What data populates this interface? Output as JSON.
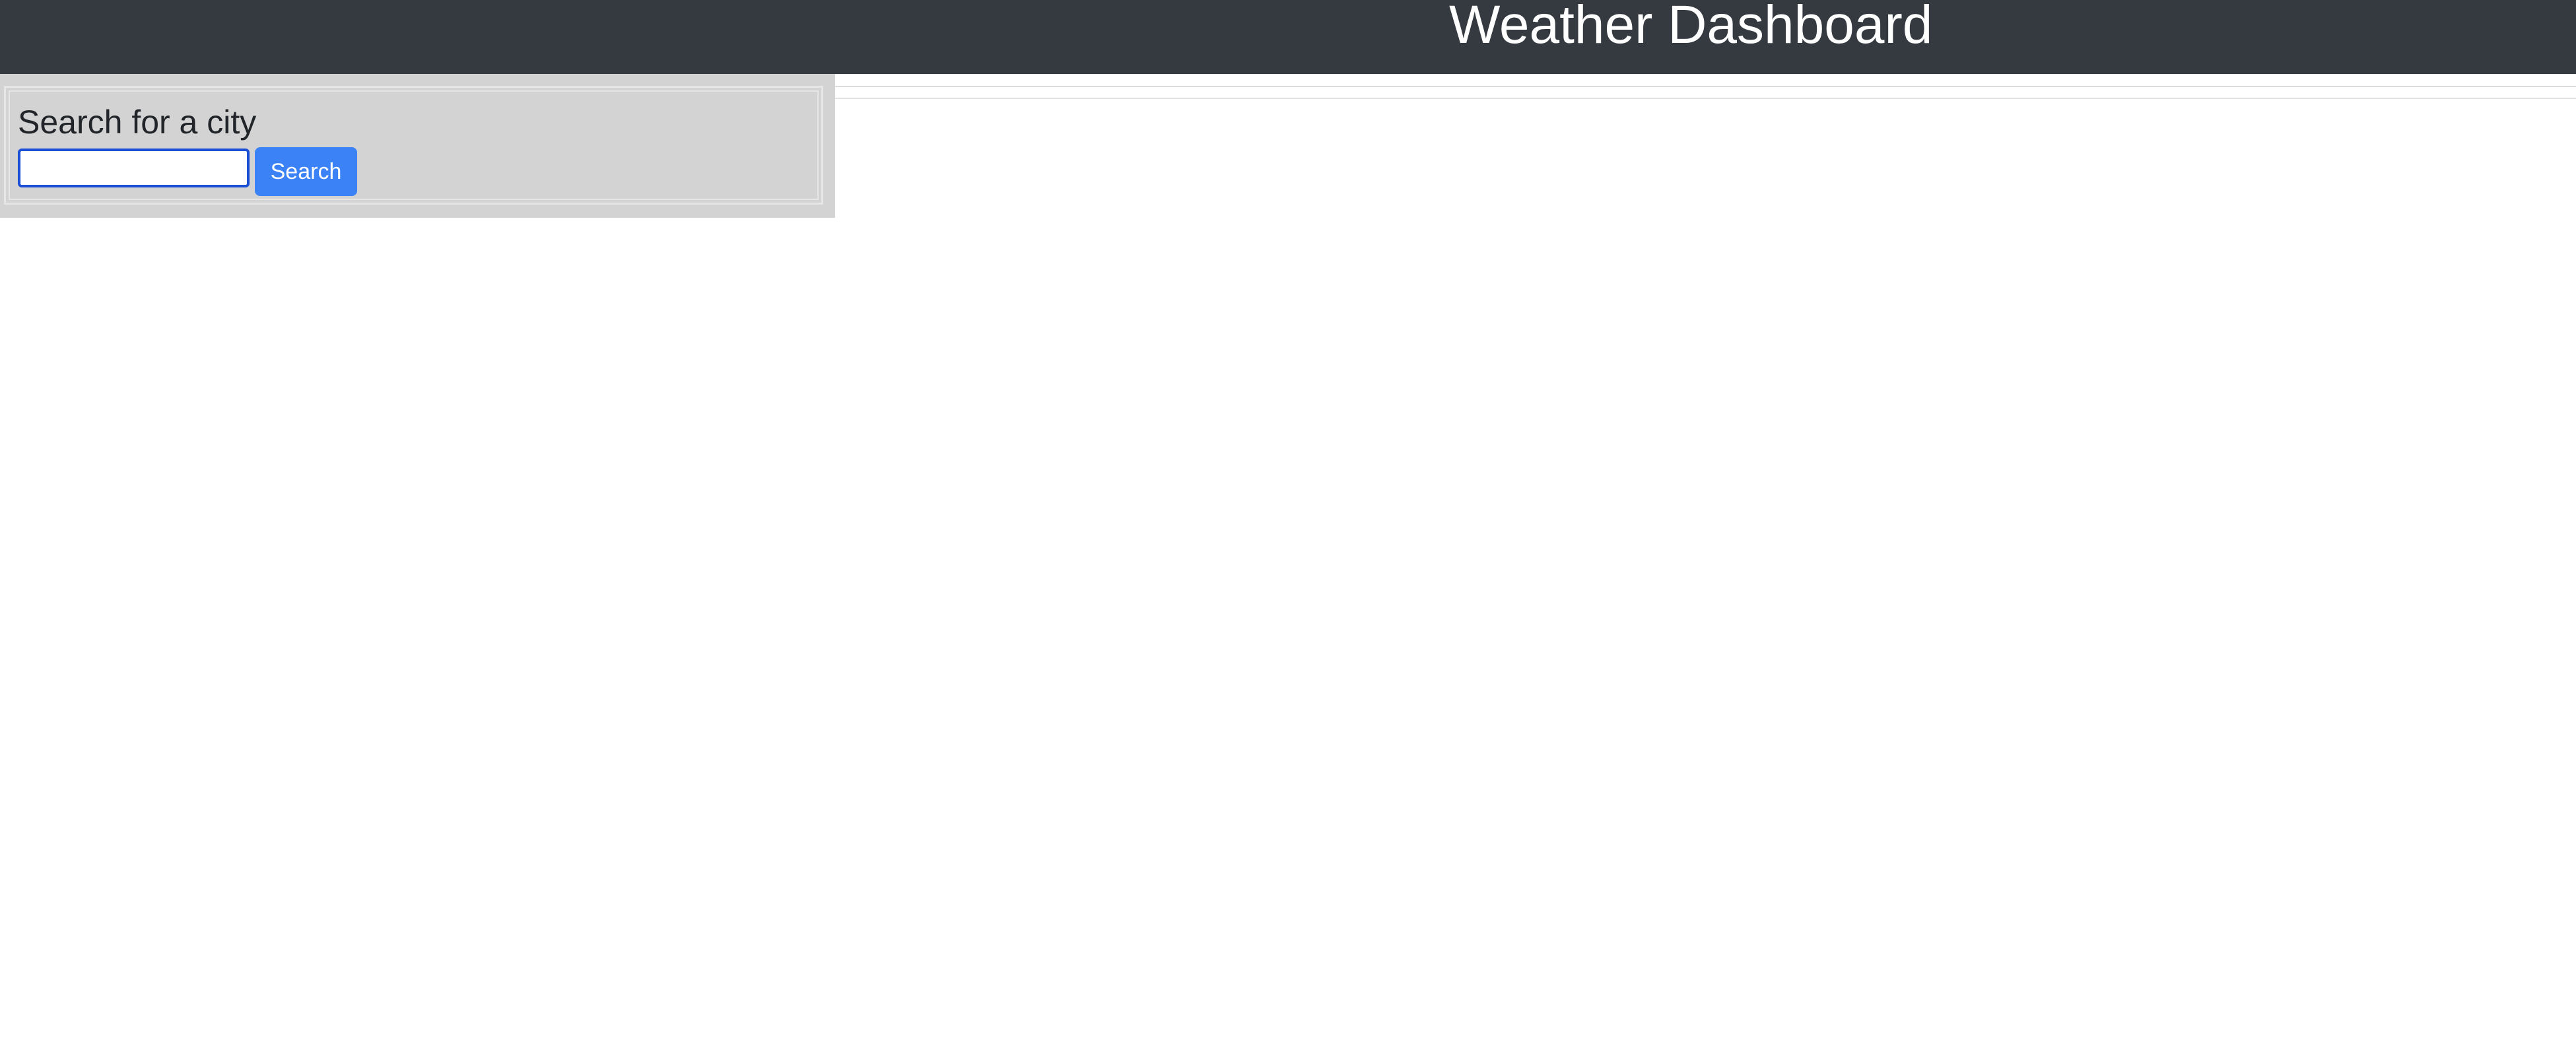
{
  "header": {
    "title": "Weather Dashboard"
  },
  "search": {
    "heading": "Search for a city",
    "input_value": "",
    "input_placeholder": "",
    "button_label": "Search"
  },
  "colors": {
    "header_bg": "#343a40",
    "sidebar_bg": "#d3d3d3",
    "button_bg": "#3b82f6",
    "input_focus": "#1a4fd6"
  }
}
